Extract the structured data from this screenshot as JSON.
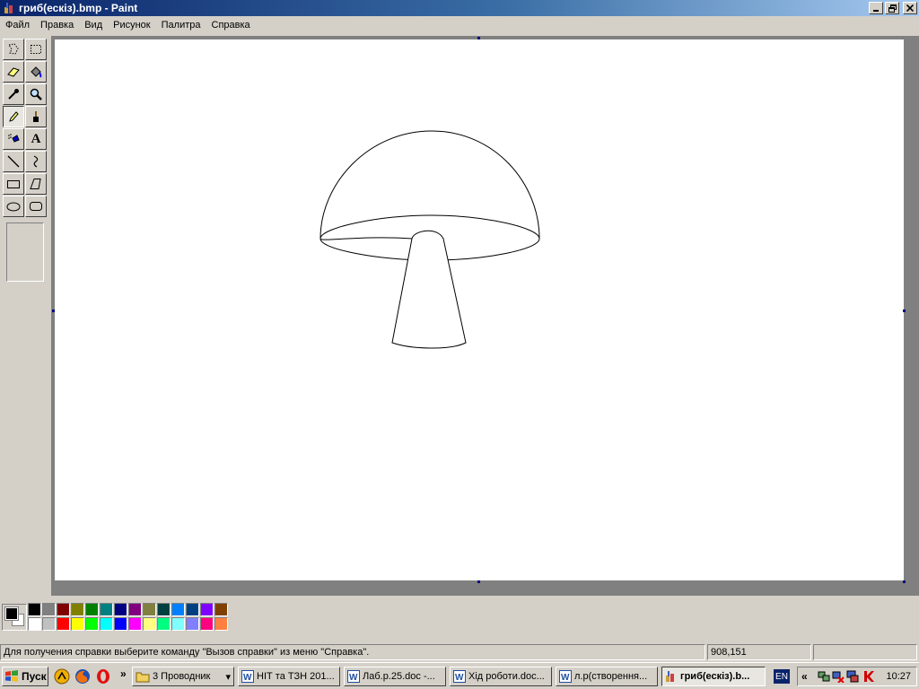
{
  "window": {
    "title": "гриб(ескіз).bmp - Paint"
  },
  "menu": [
    "Файл",
    "Правка",
    "Вид",
    "Рисунок",
    "Палитра",
    "Справка"
  ],
  "tools": [
    {
      "name": "free-form-select-icon"
    },
    {
      "name": "select-icon"
    },
    {
      "name": "eraser-icon"
    },
    {
      "name": "fill-with-color-icon"
    },
    {
      "name": "pick-color-icon"
    },
    {
      "name": "magnifier-icon"
    },
    {
      "name": "pencil-icon",
      "active": true
    },
    {
      "name": "brush-icon"
    },
    {
      "name": "airbrush-icon"
    },
    {
      "name": "text-icon",
      "glyph": "A"
    },
    {
      "name": "line-icon"
    },
    {
      "name": "curve-icon"
    },
    {
      "name": "rectangle-icon"
    },
    {
      "name": "polygon-icon"
    },
    {
      "name": "ellipse-icon"
    },
    {
      "name": "rounded-rectangle-icon"
    }
  ],
  "palette": {
    "foreground": "#000000",
    "background": "#ffffff",
    "top_row": [
      "#000000",
      "#808080",
      "#800000",
      "#808000",
      "#008000",
      "#008080",
      "#000080",
      "#800080",
      "#808040",
      "#004040",
      "#0080ff",
      "#004080",
      "#8000ff",
      "#804000"
    ],
    "bottom_row": [
      "#ffffff",
      "#c0c0c0",
      "#ff0000",
      "#ffff00",
      "#00ff00",
      "#00ffff",
      "#0000ff",
      "#ff00ff",
      "#ffff80",
      "#00ff80",
      "#80ffff",
      "#8080ff",
      "#ff0080",
      "#ff8040"
    ]
  },
  "status": {
    "help_text": "Для получения справки выберите команду \"Вызов справки\" из меню \"Справка\".",
    "coordinates": "908,151",
    "size": ""
  },
  "taskbar": {
    "start_label": "Пуск",
    "expand_label": "»",
    "buttons": [
      {
        "label": "3 Проводник",
        "icon": "folder-icon",
        "dropdown": "▾"
      },
      {
        "label": "НІТ та ТЗН 201...",
        "icon": "word-icon"
      },
      {
        "label": "Лаб.р.25.doc -...",
        "icon": "word-icon"
      },
      {
        "label": "Хід роботи.doc...",
        "icon": "word-icon"
      },
      {
        "label": "л.р(створення...",
        "icon": "word-icon"
      },
      {
        "label": "гриб(ескіз).b...",
        "icon": "paint-icon",
        "active": true
      }
    ],
    "language": "EN",
    "tray_expand": "«",
    "clock": "10:27"
  }
}
